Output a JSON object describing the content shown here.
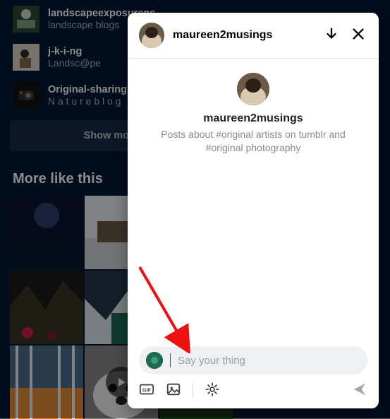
{
  "sidebar": {
    "blogs": [
      {
        "name": "landscapeexposurens",
        "desc": "landscape blogs"
      },
      {
        "name": "j-k-i-ng",
        "desc": "Landsc@pe"
      },
      {
        "name": "Original-sharing",
        "desc": "N a t u r e b l o g"
      }
    ],
    "show_more": "Show more blogs"
  },
  "section_title": "More like this",
  "panel": {
    "header": {
      "username": "maureen2musings"
    },
    "profile": {
      "name": "maureen2musings",
      "desc": "Posts about #original artists on tumblr and #original photography"
    },
    "input": {
      "placeholder": "Say your thing"
    }
  }
}
